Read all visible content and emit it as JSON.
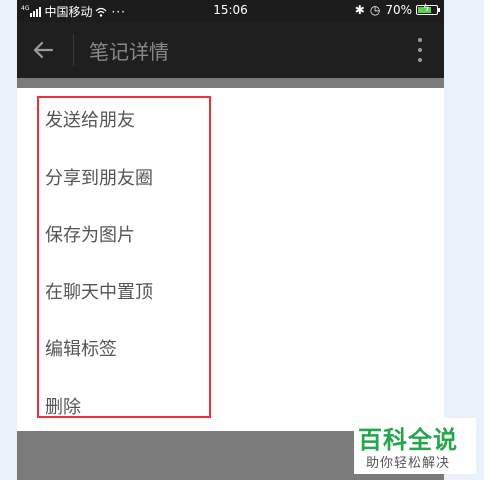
{
  "status_bar": {
    "carrier_prefix": "4G",
    "carrier": "中国移动",
    "more": "···",
    "time": "15:06",
    "bluetooth_glyph": "✱",
    "alarm_glyph": "◷",
    "battery": "70%",
    "battery_level_percent": 70
  },
  "app_bar": {
    "title": "笔记详情",
    "back_icon": "arrow-left-icon",
    "overflow_icon": "more-vertical-icon"
  },
  "menu": {
    "items": [
      "发送给朋友",
      "分享到朋友圈",
      "保存为图片",
      "在聊天中置顶",
      "编辑标签",
      "删除"
    ]
  },
  "watermark": {
    "title": "百科全说",
    "subtitle": "助你轻松解决"
  },
  "colors": {
    "highlight": "#e8323c",
    "watermark_green": "#23a74a",
    "battery_green": "#58d24c"
  }
}
